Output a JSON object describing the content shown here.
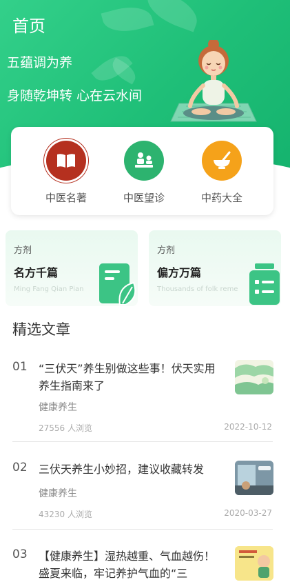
{
  "header": {
    "title": "首页",
    "slogan_line1": "五蕴调为养",
    "slogan_line2": "身随乾坤转 心在云水间"
  },
  "categories": [
    {
      "label": "中医名著",
      "icon": "book-icon",
      "color": "#b5301f"
    },
    {
      "label": "中医望诊",
      "icon": "diagnosis-icon",
      "color": "#2db36f"
    },
    {
      "label": "中药大全",
      "icon": "mortar-icon",
      "color": "#f5a21a"
    }
  ],
  "promos": [
    {
      "tag": "方剂",
      "title": "名方千篇",
      "subtitle": "Ming Fang Qian Pian"
    },
    {
      "tag": "方剂",
      "title": "偏方万篇",
      "subtitle": "Thousands of folk reme"
    }
  ],
  "section_title": "精选文章",
  "articles": [
    {
      "num": "01",
      "title": "“三伏天”养生别做这些事！伏天实用养生指南来了",
      "category": "健康养生",
      "views": "27556 人浏览",
      "date": "2022-10-12"
    },
    {
      "num": "02",
      "title": "三伏天养生小妙招，建议收藏转发",
      "category": "健康养生",
      "views": "43230 人浏览",
      "date": "2020-03-27"
    },
    {
      "num": "03",
      "title": "【健康养生】湿热越重、气血越伤！盛夏来临，牢记养护气血的“三",
      "category": "",
      "views": "",
      "date": ""
    }
  ],
  "colors": {
    "brand": "#1fbf78",
    "accent_red": "#b5301f",
    "accent_orange": "#f5a21a"
  }
}
